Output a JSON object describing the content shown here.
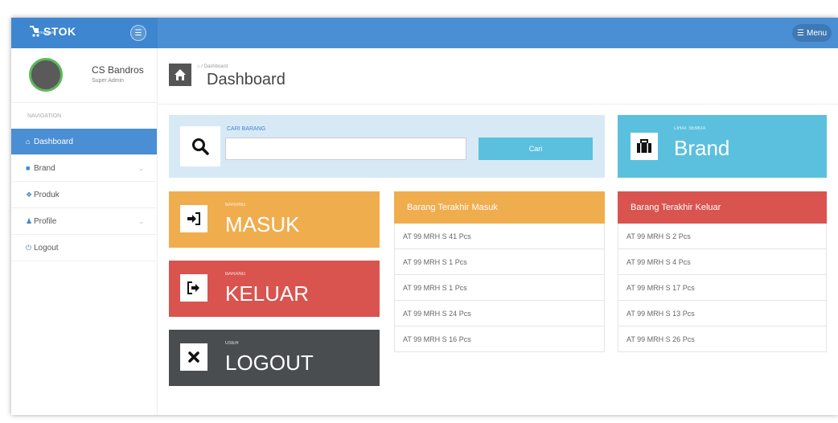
{
  "app": {
    "logo_text": "STOK",
    "logo_subtext": "manager",
    "menu_label": "Menu"
  },
  "user": {
    "name": "CS Bandros",
    "role": "Super Admin"
  },
  "sidebar": {
    "header": "NAVIGATION",
    "items": [
      {
        "label": "Dashboard",
        "icon": "home-icon",
        "active": true
      },
      {
        "label": "Brand",
        "icon": "briefcase-icon",
        "has_children": true
      },
      {
        "label": "Produk",
        "icon": "cubes-icon"
      },
      {
        "label": "Profile",
        "icon": "user-icon",
        "has_children": true
      },
      {
        "label": "Logout",
        "icon": "power-icon"
      }
    ]
  },
  "page": {
    "breadcrumb": "Dashboard",
    "title": "Dashboard"
  },
  "search": {
    "label": "CARI BARANG",
    "value": "",
    "button": "Cari"
  },
  "tiles": {
    "brand": {
      "small": "LIHAT SEMUA",
      "big": "Brand",
      "color": "#5bc0de"
    },
    "masuk": {
      "small": "BARANG",
      "big": "MASUK",
      "color": "#f0ad4e"
    },
    "keluar": {
      "small": "BARANG",
      "big": "KELUAR",
      "color": "#d9534f"
    },
    "logout": {
      "small": "USER",
      "big": "LOGOUT",
      "color": "#4a4d50"
    }
  },
  "lists": {
    "masuk": {
      "title": "Barang Terakhir Masuk",
      "rows": [
        "AT 99 MRH S 41 Pcs",
        "AT 99 MRH S 1 Pcs",
        "AT 99 MRH S 1 Pcs",
        "AT 99 MRH S 24 Pcs",
        "AT 99 MRH S 16 Pcs"
      ]
    },
    "keluar": {
      "title": "Barang Terakhir Keluar",
      "rows": [
        "AT 99 MRH S 2 Pcs",
        "AT 99 MRH S 4 Pcs",
        "AT 99 MRH S 17 Pcs",
        "AT 99 MRH S 13 Pcs",
        "AT 99 MRH S 26 Pcs"
      ]
    }
  }
}
